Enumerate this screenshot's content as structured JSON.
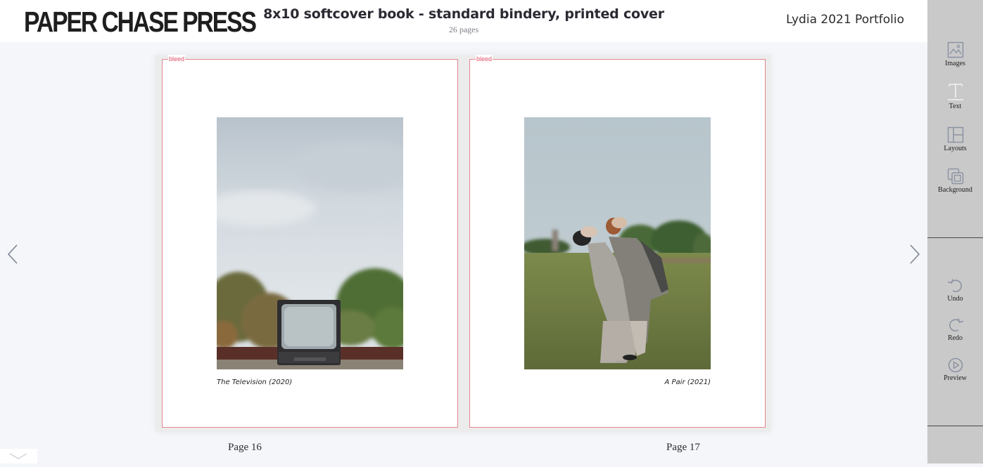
{
  "header": {
    "logo": "PAPER CHASE PRESS",
    "product_title": "8x10 softcover book - standard bindery, printed cover",
    "page_count": "26 pages",
    "project_name": "Lydia 2021 Portfolio"
  },
  "sidebar": {
    "tools": [
      {
        "label": "Images",
        "icon": "image-icon"
      },
      {
        "label": "Text",
        "icon": "text-icon"
      },
      {
        "label": "Layouts",
        "icon": "layout-icon"
      },
      {
        "label": "Background",
        "icon": "background-icon"
      }
    ],
    "actions": [
      {
        "label": "Undo",
        "icon": "undo-icon"
      },
      {
        "label": "Redo",
        "icon": "redo-icon"
      },
      {
        "label": "Preview",
        "icon": "play-icon"
      }
    ]
  },
  "spread": {
    "left_page": {
      "bleed_label": "bleed",
      "caption": "The Television (2020)",
      "page_label": "Page 16",
      "photo_subject": "Vintage television on a ledge under cloudy sky"
    },
    "right_page": {
      "bleed_label": "bleed",
      "caption": "A Pair (2021)",
      "page_label": "Page 17",
      "photo_subject": "Two people in grey suits leaning back in a grassy field"
    }
  },
  "navigation": {
    "prev": "previous-spread",
    "next": "next-spread"
  },
  "colors": {
    "bleed_line": "#e2868e",
    "bleed_text": "#e0506a",
    "sidebar_bg": "#c9c9c9",
    "canvas_bg": "#f4f6f9",
    "icon_color": "#8c93a3"
  }
}
